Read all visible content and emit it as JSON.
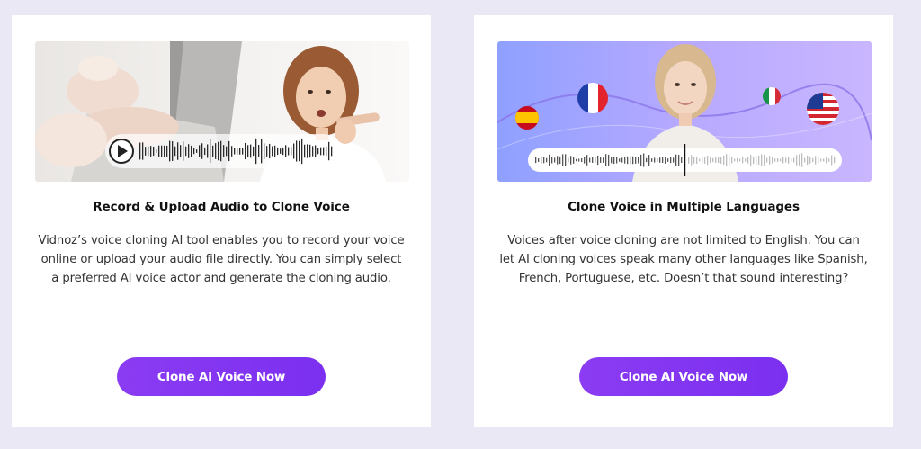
{
  "cards": [
    {
      "title": "Record & Upload Audio to Clone Voice",
      "description": "Vidnoz’s voice cloning AI tool enables you to record your voice online or upload your audio file directly. You can simply select a preferred AI voice actor and generate the cloning audio.",
      "button_label": "Clone AI Voice Now",
      "image_icons": [
        "play-icon",
        "waveform-icon"
      ]
    },
    {
      "title": "Clone Voice in Multiple Languages",
      "description": "Voices after voice cloning are not limited to English. You can let AI cloning voices speak many other languages like Spanish, French, Portuguese, etc. Doesn’t that sound interesting?",
      "button_label": "Clone AI Voice Now",
      "image_icons": [
        "spain-flag-icon",
        "france-flag-icon",
        "italy-flag-icon",
        "usa-flag-icon",
        "waveform-icon"
      ]
    }
  ],
  "colors": {
    "page_background": "#ebe8f5",
    "card_background": "#ffffff",
    "button": "#8b3cf2",
    "banner_gradient_start": "#8fa0ff",
    "banner_gradient_end": "#c6b2ff"
  }
}
